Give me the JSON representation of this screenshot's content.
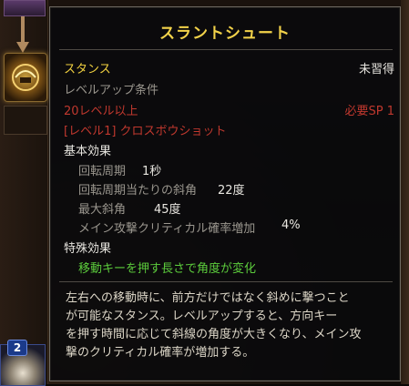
{
  "tooltip": {
    "title": "スラントシュート",
    "type": "スタンス",
    "status": "未習得",
    "levelup_header": "レベルアップ条件",
    "req_level": "20レベル以上",
    "req_sp": "必要SP 1",
    "req_skill": "[レベル1] クロスボウショット",
    "basic_header": "基本効果",
    "effects": [
      {
        "label": "回転周期",
        "value": "1秒"
      },
      {
        "label": "回転周期当たりの斜角",
        "value": "22度"
      },
      {
        "label": "最大斜角",
        "value": "45度"
      },
      {
        "label": "メイン攻撃クリティカル確率増加",
        "value": "4%"
      }
    ],
    "special_header": "特殊効果",
    "special_effect": "移動キーを押す長さで角度が変化",
    "description_lines": [
      "左右への移動時に、前方だけではなく斜めに撃つこと",
      "が可能なスタンス。レベルアップすると、方向キー",
      "を押す時間に応じて斜線の角度が大きくなり、メイン攻",
      "撃のクリティカル確率が増加する。"
    ]
  },
  "hotbar": {
    "level_badge": "2"
  },
  "colors": {
    "title": "#f2d24a",
    "requirement_unmet": "#c0382e",
    "special_effect": "#5ccc3c",
    "label_gray": "#9a968e"
  },
  "icons": [
    "arrow-down-icon",
    "stance-skill-icon",
    "crossbow-skill-icon"
  ]
}
